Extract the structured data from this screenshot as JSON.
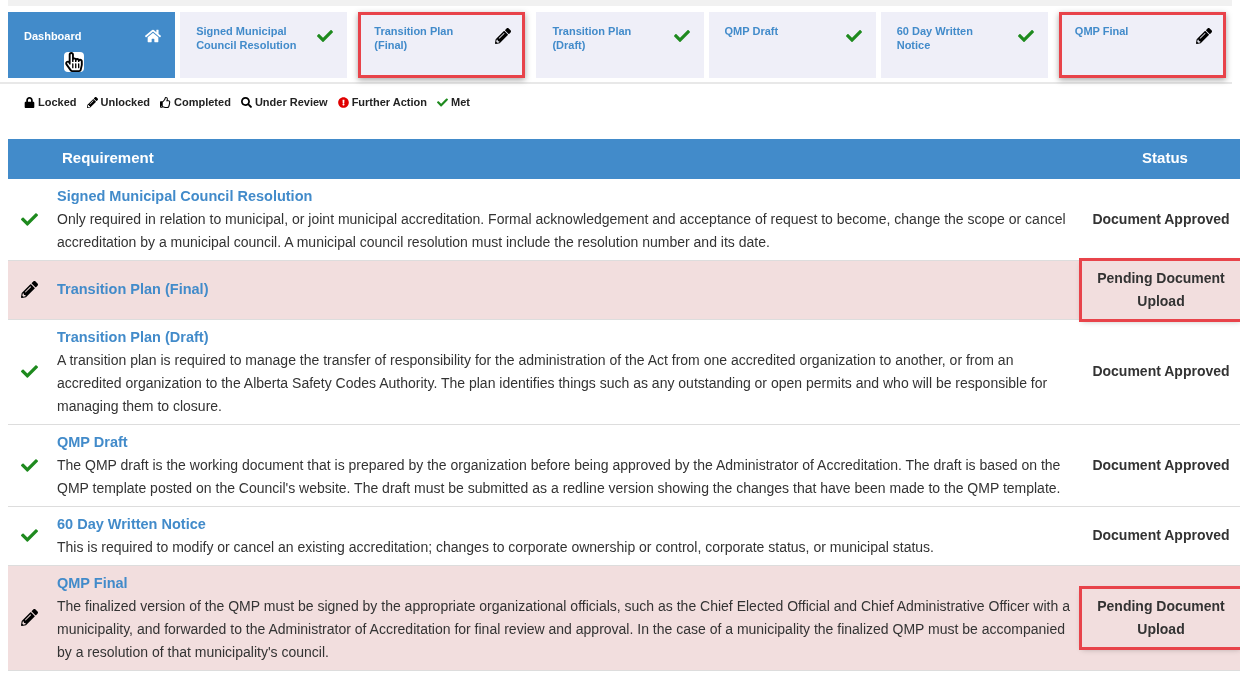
{
  "tabs": [
    {
      "label": "Dashboard",
      "kind": "home",
      "selected": true,
      "highlighted": false
    },
    {
      "label": "Signed Municipal Council Resolution",
      "kind": "met",
      "selected": false,
      "highlighted": false
    },
    {
      "label": "Transition Plan (Final)",
      "kind": "unlocked",
      "selected": false,
      "highlighted": true
    },
    {
      "label": "Transition Plan (Draft)",
      "kind": "met",
      "selected": false,
      "highlighted": false
    },
    {
      "label": "QMP Draft",
      "kind": "met",
      "selected": false,
      "highlighted": false
    },
    {
      "label": "60 Day Written Notice",
      "kind": "met",
      "selected": false,
      "highlighted": false
    },
    {
      "label": "QMP Final",
      "kind": "unlocked",
      "selected": false,
      "highlighted": true
    }
  ],
  "legend": [
    {
      "kind": "locked",
      "label": "Locked"
    },
    {
      "kind": "unlocked",
      "label": "Unlocked"
    },
    {
      "kind": "completed",
      "label": "Completed"
    },
    {
      "kind": "review",
      "label": "Under Review"
    },
    {
      "kind": "action",
      "label": "Further Action"
    },
    {
      "kind": "met",
      "label": "Met"
    }
  ],
  "table": {
    "columns": [
      "Requirement",
      "Status"
    ],
    "rows": [
      {
        "kind": "met",
        "title": "Signed Municipal Council Resolution",
        "description": "Only required in relation to municipal, or joint municipal accreditation. Formal acknowledgement and acceptance of request to become, change the scope or cancel accreditation by a municipal council. A municipal council resolution must include the resolution number and its date.",
        "status": "Document Approved",
        "highlighted": false
      },
      {
        "kind": "unlocked",
        "title": "Transition Plan (Final)",
        "status": "Pending Document Upload",
        "highlighted": true
      },
      {
        "kind": "met",
        "title": "Transition Plan (Draft)",
        "description": "A transition plan is required to manage the transfer of responsibility for the administration of the Act from one accredited organization to another, or from an accredited organization to the Alberta Safety Codes Authority. The plan identifies things such as any outstanding or open permits and who will be responsible for managing them to closure.",
        "status": "Document Approved",
        "highlighted": false
      },
      {
        "kind": "met",
        "title": "QMP Draft",
        "description": "The QMP draft is the working document that is prepared by the organization before being approved by the Administrator of Accreditation. The draft is based on the QMP template posted on the Council's website. The draft must be submitted as a redline version showing the changes that have been made to the QMP template.",
        "status": "Document Approved",
        "highlighted": false
      },
      {
        "kind": "met",
        "title": "60 Day Written Notice",
        "description": "This is required to modify or cancel an existing accreditation; changes to corporate ownership or control, corporate status, or municipal status.",
        "status": "Document Approved",
        "highlighted": false
      },
      {
        "kind": "unlocked",
        "title": "QMP Final",
        "description": "The finalized version of the QMP must be signed by the appropriate organizational officials, such as the Chief Elected Official and Chief Administrative Officer with a municipality, and forwarded to the Administrator of Accreditation for final review and approval. In the case of a municipality the finalized QMP must be accompanied by a resolution of that municipality's council.",
        "status": "Pending Document Upload",
        "highlighted": true
      }
    ]
  }
}
